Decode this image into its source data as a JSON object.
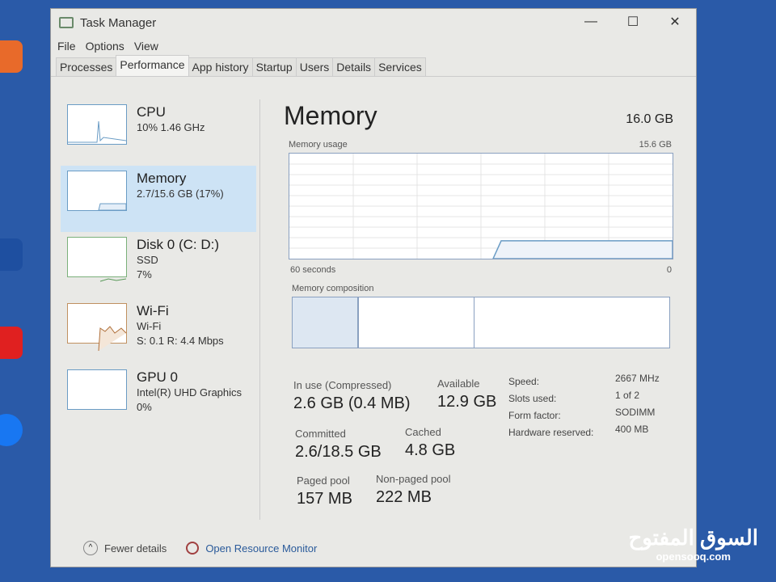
{
  "window": {
    "title": "Task Manager",
    "minimize": "—",
    "maximize": "☐",
    "close": "✕"
  },
  "menu": [
    "File",
    "Options",
    "View"
  ],
  "tabs": [
    {
      "label": "Processes"
    },
    {
      "label": "Performance",
      "active": true
    },
    {
      "label": "App history"
    },
    {
      "label": "Startup"
    },
    {
      "label": "Users"
    },
    {
      "label": "Details"
    },
    {
      "label": "Services"
    }
  ],
  "sidebar": [
    {
      "name": "CPU",
      "sub1": "10% 1.46 GHz",
      "sub2": ""
    },
    {
      "name": "Memory",
      "sub1": "2.7/15.6 GB (17%)",
      "sub2": "",
      "active": true
    },
    {
      "name": "Disk 0 (C: D:)",
      "sub1": "SSD",
      "sub2": "7%"
    },
    {
      "name": "Wi-Fi",
      "sub1": "Wi-Fi",
      "sub2": "S: 0.1 R: 4.4 Mbps"
    },
    {
      "name": "GPU 0",
      "sub1": "Intel(R) UHD Graphics",
      "sub2": "0%"
    }
  ],
  "main": {
    "title": "Memory",
    "total": "16.0 GB",
    "usage_label": "Memory usage",
    "usage_max": "15.6 GB",
    "time_label": "60 seconds",
    "zero": "0",
    "usage_percent": 17,
    "composition_label": "Memory composition",
    "stats": {
      "in_use_label": "In use (Compressed)",
      "in_use": "2.6 GB (0.4 MB)",
      "available_label": "Available",
      "available": "12.9 GB",
      "committed_label": "Committed",
      "committed": "2.6/18.5 GB",
      "cached_label": "Cached",
      "cached": "4.8 GB",
      "paged_label": "Paged pool",
      "paged": "157 MB",
      "nonpaged_label": "Non-paged pool",
      "nonpaged": "222 MB"
    },
    "specs": [
      {
        "k": "Speed:",
        "v": "2667 MHz"
      },
      {
        "k": "Slots used:",
        "v": "1 of 2"
      },
      {
        "k": "Form factor:",
        "v": "SODIMM"
      },
      {
        "k": "Hardware reserved:",
        "v": "400 MB"
      }
    ]
  },
  "footer": {
    "fewer": "Fewer details",
    "monitor": "Open Resource Monitor"
  },
  "watermark": {
    "arabic": "السوق المفتوح",
    "latin": "opensooq.com"
  },
  "colors": {
    "accent": "#cde3f5",
    "graph_line": "#6a9cc5",
    "desktop": "#2a5aa8"
  }
}
